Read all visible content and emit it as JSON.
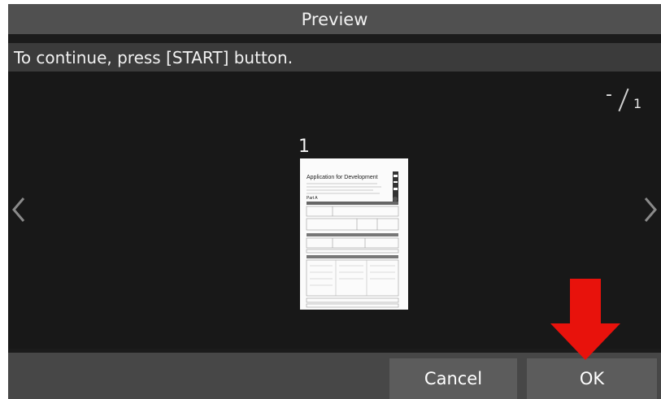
{
  "window": {
    "title": "Preview"
  },
  "message": {
    "text": "To continue, press [START] button."
  },
  "page_counter": {
    "current": "-",
    "total": "1"
  },
  "thumbnail": {
    "page_number": "1",
    "document_title": "Application for Development",
    "section_label": "Part A"
  },
  "buttons": {
    "cancel_label": "Cancel",
    "ok_label": "OK"
  },
  "colors": {
    "highlight_arrow": "#e8120c",
    "background": "#1b1b1b",
    "title_bar": "#505050"
  },
  "icons": {
    "prev": "chevron-left-icon",
    "next": "chevron-right-icon",
    "indicator": "down-arrow-indicator-icon"
  }
}
